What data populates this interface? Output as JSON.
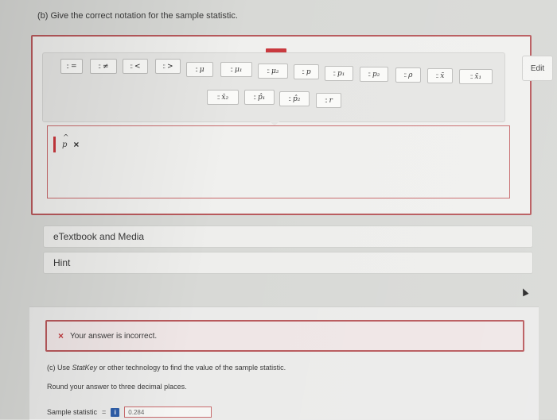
{
  "question_b": {
    "text": "(b) Give the correct notation for the sample statistic."
  },
  "palette": {
    "row1": [
      {
        "glyph": "::",
        "sym": "="
      },
      {
        "glyph": "::",
        "sym": "≠"
      },
      {
        "glyph": "::",
        "sym": "<"
      },
      {
        "glyph": "::",
        "sym": ">"
      },
      {
        "glyph": "::",
        "sym": "μ"
      },
      {
        "glyph": "::",
        "sym": "μ₁"
      },
      {
        "glyph": "::",
        "sym": "μ₂"
      },
      {
        "glyph": "::",
        "sym": "p"
      },
      {
        "glyph": "::",
        "sym": "p₁"
      },
      {
        "glyph": "::",
        "sym": "p₂"
      },
      {
        "glyph": "::",
        "sym": "ρ"
      },
      {
        "glyph": "::",
        "sym": "x̄"
      },
      {
        "glyph": "::",
        "sym": "x̄₁"
      }
    ],
    "row2": [
      {
        "glyph": "::",
        "sym": "x̄₂"
      },
      {
        "glyph": "::",
        "sym": "p̂₁"
      },
      {
        "glyph": "::",
        "sym": "p̂₂"
      },
      {
        "glyph": "::",
        "sym": "r"
      }
    ]
  },
  "edit_label": "Edit",
  "answer": {
    "value": "p",
    "remove": "×"
  },
  "etextbook": "eTextbook and Media",
  "hint": "Hint",
  "feedback": {
    "icon": "×",
    "text": "Your answer is incorrect."
  },
  "question_c": {
    "prompt_prefix": "(c) Use ",
    "prompt_italic": "StatKey",
    "prompt_suffix": " or other technology to find the value of the sample statistic.",
    "rounding": "Round your answer to three decimal places."
  },
  "sample_statistic": {
    "label": "Sample statistic",
    "equals": "=",
    "info": "i",
    "value": "0.284"
  }
}
